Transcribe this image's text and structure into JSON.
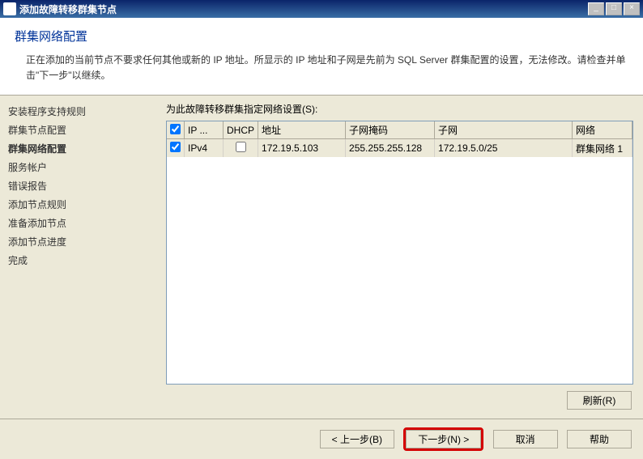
{
  "titlebar": {
    "text": "添加故障转移群集节点"
  },
  "header": {
    "title": "群集网络配置",
    "desc": "正在添加的当前节点不要求任何其他或新的 IP 地址。所显示的 IP 地址和子网是先前为 SQL Server 群集配置的设置，无法修改。请检查并单击\"下一步\"以继续。"
  },
  "sidebar": {
    "items": [
      {
        "label": "安装程序支持规则"
      },
      {
        "label": "群集节点配置"
      },
      {
        "label": "群集网络配置",
        "active": true
      },
      {
        "label": "服务帐户"
      },
      {
        "label": "错误报告"
      },
      {
        "label": "添加节点规则"
      },
      {
        "label": "准备添加节点"
      },
      {
        "label": "添加节点进度"
      },
      {
        "label": "完成"
      }
    ]
  },
  "content": {
    "label": "为此故障转移群集指定网络设置(S):",
    "columns": {
      "check": "",
      "iptype": "IP ...",
      "dhcp": "DHCP",
      "address": "地址",
      "mask": "子网掩码",
      "subnet": "子网",
      "network": "网络"
    },
    "rows": [
      {
        "checked": true,
        "iptype": "IPv4",
        "dhcp": false,
        "address": "172.19.5.103",
        "mask": "255.255.255.128",
        "subnet": "172.19.5.0/25",
        "network": "群集网络 1"
      }
    ],
    "refresh": "刷新(R)"
  },
  "footer": {
    "back": "< 上一步(B)",
    "next": "下一步(N) >",
    "cancel": "取消",
    "help": "帮助"
  }
}
